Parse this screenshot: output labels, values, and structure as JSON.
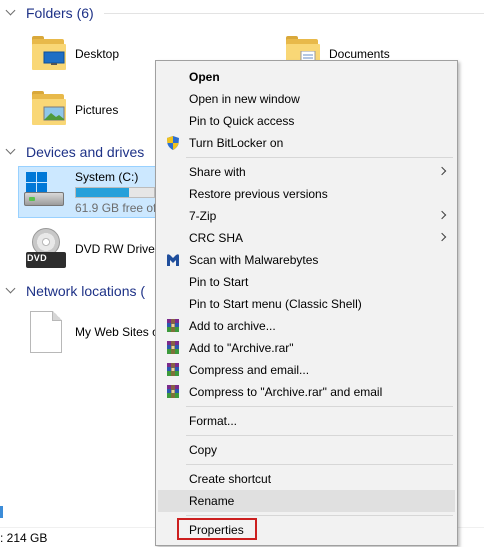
{
  "explorer": {
    "folders_header": "Folders (6)",
    "devices_header": "Devices and drives",
    "network_header": "Network locations (",
    "folders": [
      {
        "label": "Desktop"
      },
      {
        "label": "Documents"
      },
      {
        "label": "Pictures"
      }
    ],
    "drive": {
      "label": "System (C:)",
      "free": "61.9 GB free of",
      "used_fraction": 0.68
    },
    "dvd": {
      "label": "DVD RW Drive",
      "badge": "DVD"
    },
    "network_item": {
      "label": "My Web Sites o"
    },
    "status_text": ": 214 GB"
  },
  "context_menu": {
    "groups": [
      [
        {
          "label": "Open",
          "bold": true
        },
        {
          "label": "Open in new window"
        },
        {
          "label": "Pin to Quick access"
        },
        {
          "label": "Turn BitLocker on",
          "icon": "shield-icon"
        }
      ],
      [
        {
          "label": "Share with",
          "submenu": true
        },
        {
          "label": "Restore previous versions"
        },
        {
          "label": "7-Zip",
          "submenu": true
        },
        {
          "label": "CRC SHA",
          "submenu": true
        },
        {
          "label": "Scan with Malwarebytes",
          "icon": "malwarebytes-icon"
        },
        {
          "label": "Pin to Start"
        },
        {
          "label": "Pin to Start menu (Classic Shell)"
        },
        {
          "label": "Add to archive...",
          "icon": "winrar-icon"
        },
        {
          "label": "Add to \"Archive.rar\"",
          "icon": "winrar-icon"
        },
        {
          "label": "Compress and email...",
          "icon": "winrar-icon"
        },
        {
          "label": "Compress to \"Archive.rar\" and email",
          "icon": "winrar-icon"
        }
      ],
      [
        {
          "label": "Format..."
        }
      ],
      [
        {
          "label": "Copy"
        }
      ],
      [
        {
          "label": "Create shortcut"
        },
        {
          "label": "Rename",
          "hover": true
        }
      ],
      [
        {
          "label": "Properties",
          "highlighted": true
        }
      ]
    ]
  },
  "colors": {
    "header_text": "#1e3287",
    "selection_bg": "#cce8ff",
    "capacity_fill": "#26a0da",
    "highlight_border": "#cc1f1f"
  }
}
